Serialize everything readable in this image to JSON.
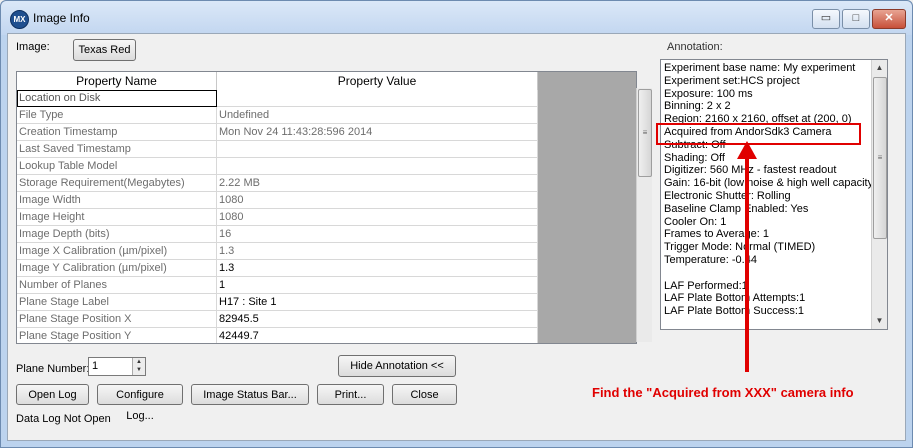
{
  "window": {
    "title": "Image Info",
    "app_icon": "MX",
    "controls": {
      "minimize": "▭",
      "maximize": "□",
      "close": "✕"
    }
  },
  "image": {
    "label": "Image:",
    "button": "Texas Red"
  },
  "grid": {
    "col_name": "Property Name",
    "col_value": "Property Value",
    "rows": [
      {
        "name": "Location on Disk",
        "value": ""
      },
      {
        "name": "File Type",
        "value": "Undefined"
      },
      {
        "name": "Creation Timestamp",
        "value": "Mon Nov 24 11:43:28:596 2014"
      },
      {
        "name": "Last Saved Timestamp",
        "value": ""
      },
      {
        "name": "Lookup Table Model",
        "value": ""
      },
      {
        "name": "Storage Requirement(Megabytes)",
        "value": "2.22 MB"
      },
      {
        "name": "Image Width",
        "value": "1080"
      },
      {
        "name": "Image Height",
        "value": "1080"
      },
      {
        "name": "Image Depth (bits)",
        "value": "16"
      },
      {
        "name": "Image X Calibration (µm/pixel)",
        "value": "1.3"
      },
      {
        "name": "Image Y Calibration (µm/pixel)",
        "value": "1.3"
      },
      {
        "name": "Number of Planes",
        "value": "1"
      },
      {
        "name": "Plane Stage Label",
        "value": "H17 : Site 1"
      },
      {
        "name": "Plane Stage Position X",
        "value": "82945.5"
      },
      {
        "name": "Plane Stage Position Y",
        "value": "42449.7"
      }
    ]
  },
  "annotation": {
    "label": "Annotation:",
    "lines": [
      "Experiment base name: My experiment",
      "Experiment set:HCS project",
      "Exposure: 100 ms",
      "Binning: 2 x 2",
      "Region: 2160 x 2160, offset at (200, 0)",
      "Acquired from AndorSdk3 Camera",
      "Subtract: Off",
      "Shading: Off",
      "Digitizer: 560 MHz - fastest readout",
      "Gain: 16-bit (low noise & high well capacity)",
      "Electronic Shutter: Rolling",
      "Baseline Clamp Enabled: Yes",
      "Cooler On: 1",
      "Frames to Average: 1",
      "Trigger Mode: Normal (TIMED)",
      "Temperature: -0.44",
      "",
      "LAF Performed:1",
      "LAF Plate Bottom Attempts:1",
      "LAF Plate Bottom Success:1"
    ]
  },
  "plane": {
    "label": "Plane Number:",
    "value": "1"
  },
  "buttons": {
    "hide_annotation": "Hide Annotation <<",
    "open_log": "Open Log",
    "configure_log": "Configure Log...",
    "status_bar": "Image Status Bar...",
    "print": "Print...",
    "close": "Close"
  },
  "status": "Data Log Not Open",
  "callout": "Find the \"Acquired from XXX\" camera info",
  "colors": {
    "highlight": "#e00000",
    "title_bg": "#c2d6f0"
  }
}
